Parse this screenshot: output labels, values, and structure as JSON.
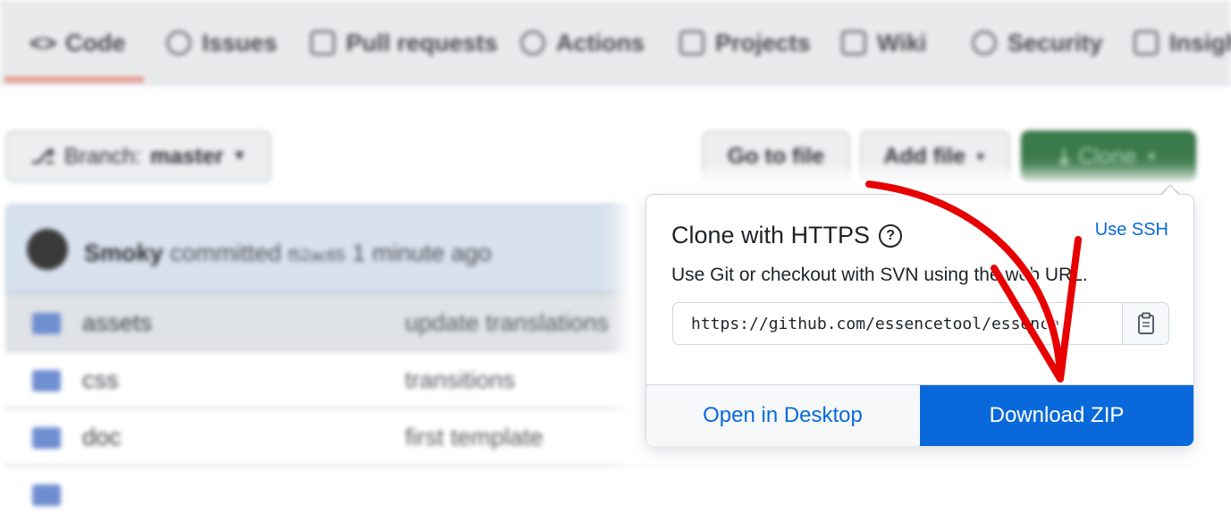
{
  "repo_nav": {
    "tabs": [
      {
        "label": "Code",
        "icon": "code-icon"
      },
      {
        "label": "Issues",
        "icon": "issue-icon"
      },
      {
        "label": "Pull requests",
        "icon": "pull-request-icon"
      },
      {
        "label": "Actions",
        "icon": "play-icon"
      },
      {
        "label": "Projects",
        "icon": "project-icon"
      },
      {
        "label": "Wiki",
        "icon": "book-icon"
      },
      {
        "label": "Security",
        "icon": "shield-icon"
      },
      {
        "label": "Insights",
        "icon": "graph-icon"
      }
    ]
  },
  "toolbar": {
    "branch_prefix": "Branch:",
    "branch_name": "master",
    "goto_file": "Go to file",
    "add_file": "Add file",
    "clone": "Clone"
  },
  "commit": {
    "author": "Smoky",
    "text": "committed",
    "hash": "f52ac65",
    "time": "1 minute ago"
  },
  "files": [
    {
      "name": "assets",
      "message": "update translations"
    },
    {
      "name": "css",
      "message": "transitions"
    },
    {
      "name": "doc",
      "message": "first template"
    },
    {
      "name": "",
      "message": ""
    }
  ],
  "clone_popup": {
    "title": "Clone with HTTPS",
    "help": "?",
    "use_ssh": "Use SSH",
    "description": "Use Git or checkout with SVN using the web URL.",
    "url": "https://github.com/essencetool/essence",
    "open_desktop": "Open in Desktop",
    "download_zip": "Download ZIP"
  },
  "colors": {
    "accent_blue": "#0969da",
    "clone_green": "#3b7a4a",
    "annotation_arrow": "#e60000"
  }
}
